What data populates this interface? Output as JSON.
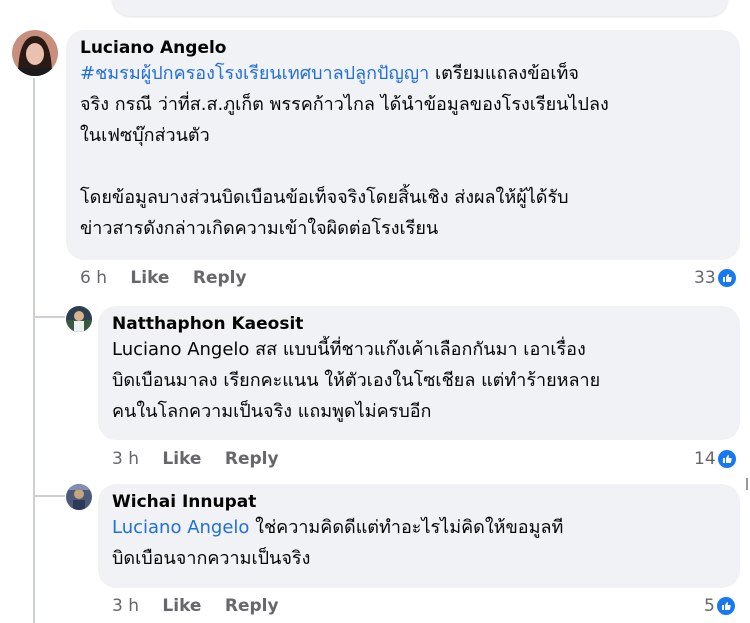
{
  "comments": [
    {
      "author": "Luciano Angelo",
      "hashtag": "#ชมรมผู้ปกครองโรงเรียนเทศบาลปลูกปัญญา",
      "line1_rest": " เตรียมแถลงข้อเท็จ",
      "line2": "จริง กรณี ว่าที่ส.ส.ภูเก็ต พรรคก้าวไกล ได้นำข้อมูลของโรงเรียนไปลง",
      "line3": "ในเฟซบุ๊กส่วนตัว",
      "line4": "โดยข้อมูลบางส่วนบิดเบือนข้อเท็จจริงโดยสิ้นเชิง ส่งผลให้ผู้ได้รับ",
      "line5": "ข่าวสารดังกล่าวเกิดความเข้าใจผิดต่อโรงเรียน",
      "time": "6 h",
      "like": "Like",
      "reply": "Reply",
      "reactions": "33"
    },
    {
      "author": "Natthaphon Kaeosit",
      "mention": "Luciano Angelo",
      "line1_rest": " สส แบบนี้ที่ชาวแก๊งเค้าเลือกกันมา เอาเรื่อง",
      "line2": "บิดเบือนมาลง เรียกคะแนน ให้ตัวเองในโซเชียล แต่ทำร้ายหลาย",
      "line3": "คนในโลกความเป็นจริง แถมพูดไม่ครบอีก",
      "time": "3 h",
      "like": "Like",
      "reply": "Reply",
      "reactions": "14"
    },
    {
      "author": "Wichai Innupat",
      "mention": "Luciano Angelo",
      "line1_rest": " ใช่ความคิดดีแต่ทำอะไรไม่คิดให้ขอมูลที",
      "line2": "บิดเบือนจากความเป็นจริง",
      "time": "3 h",
      "like": "Like",
      "reply": "Reply",
      "reactions": "5"
    }
  ],
  "colors": {
    "bubble": "#f0f2f5",
    "link": "#216fdb",
    "meta": "#65676b",
    "like_blue": "#1877f2"
  },
  "icons": [
    "avatar",
    "like-reaction-icon"
  ]
}
